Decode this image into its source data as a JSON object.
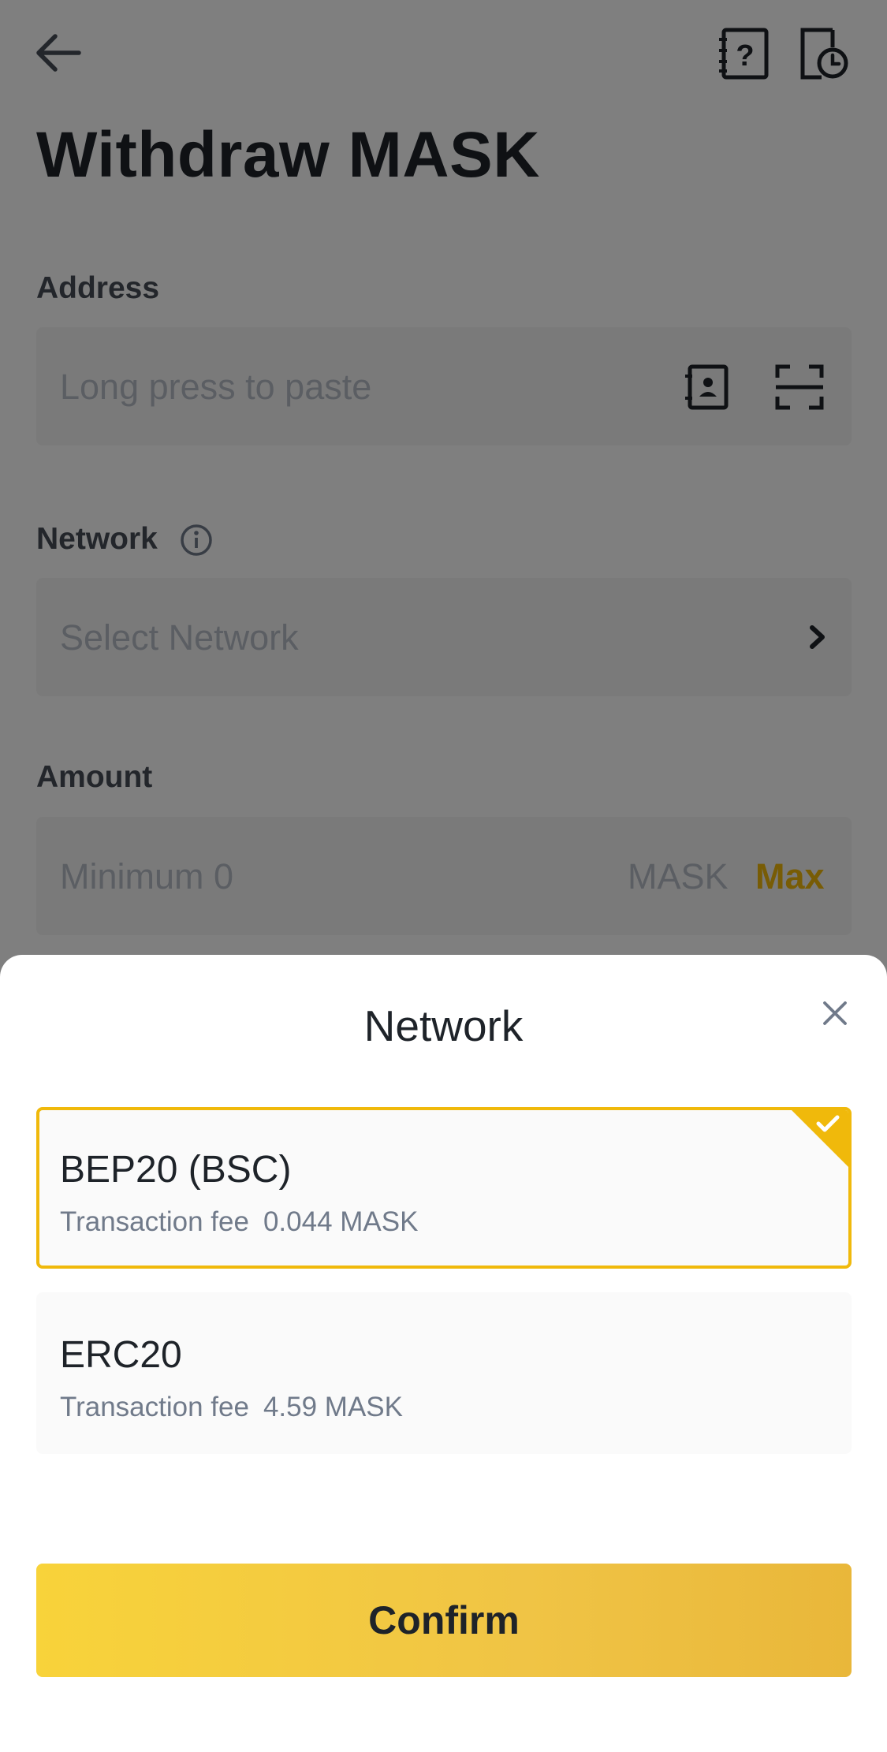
{
  "page": {
    "title": "Withdraw MASK",
    "address": {
      "label": "Address",
      "placeholder": "Long press to paste"
    },
    "network": {
      "label": "Network",
      "placeholder": "Select Network"
    },
    "amount": {
      "label": "Amount",
      "placeholder": "Minimum 0",
      "unit": "MASK",
      "max_label": "Max"
    },
    "icons": {
      "back": "back-arrow-icon",
      "faq": "faq-book-icon",
      "history": "history-clock-icon",
      "info": "info-icon",
      "contacts": "address-book-icon",
      "scan": "scan-icon",
      "chevron": "chevron-right-icon"
    }
  },
  "network_sheet": {
    "title": "Network",
    "options": [
      {
        "name": "BEP20 (BSC)",
        "fee_label": "Transaction fee",
        "fee_value": "0.044 MASK",
        "selected": true
      },
      {
        "name": "ERC20",
        "fee_label": "Transaction fee",
        "fee_value": "4.59 MASK",
        "selected": false
      }
    ],
    "confirm_label": "Confirm"
  },
  "colors": {
    "accent": "#f0b90b",
    "text_primary": "#1e2329",
    "text_secondary": "#707a8a",
    "field_bg": "#f5f5f5"
  }
}
